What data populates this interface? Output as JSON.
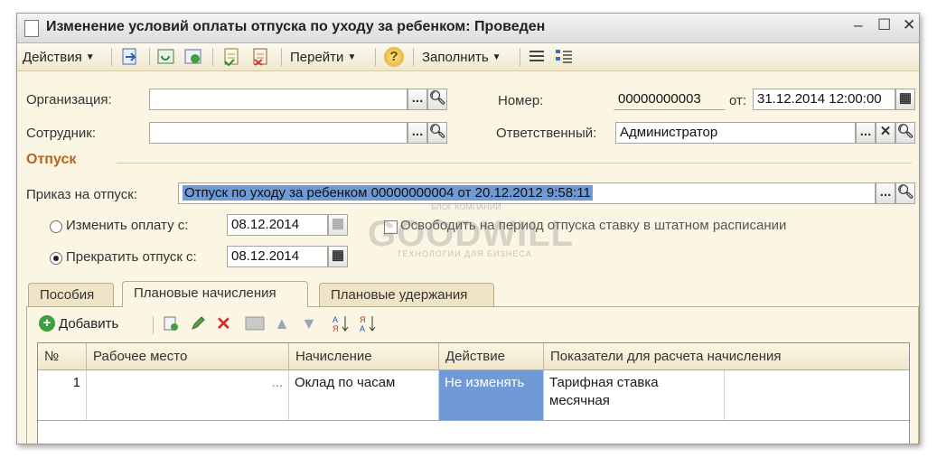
{
  "window": {
    "title": "Изменение условий оплаты отпуска по уходу за ребенком: Проведен",
    "minimize": "–",
    "maximize": "☐",
    "close": "✕"
  },
  "toolbar": {
    "actions": "Действия",
    "goto": "Перейти",
    "fill": "Заполнить",
    "help": "?"
  },
  "form": {
    "organization_label": "Организация:",
    "organization_value": "",
    "employee_label": "Сотрудник:",
    "employee_value": "",
    "number_label": "Номер:",
    "number_value": "00000000003",
    "date_label": "от:",
    "date_value": "31.12.2014 12:00:00",
    "responsible_label": "Ответственный:",
    "responsible_value": "Администратор",
    "dots": "...",
    "clear": "✕"
  },
  "leave": {
    "section_title": "Отпуск",
    "order_label": "Приказ на отпуск:",
    "order_value": "Отпуск по уходу за ребенком 00000000004 от 20.12.2012 9:58:11",
    "change_pay_label": "Изменить оплату с:",
    "change_pay_date": "08.12.2014",
    "end_leave_label": "Прекратить отпуск с:",
    "end_leave_date": "08.12.2014",
    "release_rate_label": "Освободить на период отпуска ставку в штатном расписании",
    "selected_option": "end_leave"
  },
  "watermark": {
    "top": "БЛОГ КОМПАНИИ",
    "brand": "GOODWILL",
    "sub": "ТЕХНОЛОГИИ ДЛЯ БИЗНЕСА"
  },
  "tabs": [
    {
      "label": "Пособия"
    },
    {
      "label": "Плановые начисления",
      "active": true
    },
    {
      "label": "Плановые удержания"
    }
  ],
  "grid_toolbar": {
    "add": "Добавить"
  },
  "grid": {
    "columns": [
      "№",
      "Рабочее место",
      "Начисление",
      "Действие",
      "Показатели для расчета начисления"
    ],
    "rows": [
      {
        "n": "1",
        "workplace": "...",
        "accrual": "Оклад по часам",
        "action": "Не изменять",
        "indicators": "Тарифная ставка месячная"
      }
    ]
  },
  "colors": {
    "accent_section": "#b8621c",
    "selection": "#6f9ad6",
    "window_bg": "#fbf6e3"
  }
}
